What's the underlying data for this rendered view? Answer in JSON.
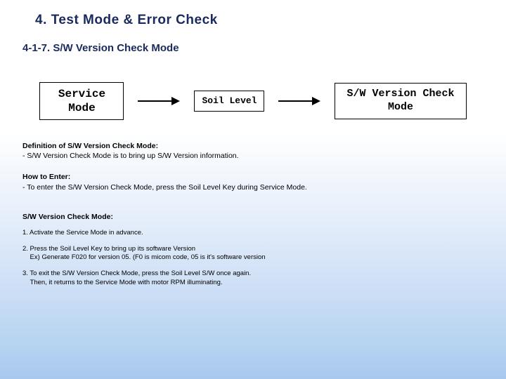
{
  "title": "4. Test Mode & Error Check",
  "subtitle": "4-1-7.  S/W Version Check Mode",
  "flow": {
    "box1_line1": "Service",
    "box1_line2": "Mode",
    "box2": "Soil Level",
    "box3_line1": "S/W Version Check",
    "box3_line2": "Mode"
  },
  "def": {
    "heading": "Definition of S/W Version Check Mode:",
    "line1": "- S/W Version Check Mode is to bring up S/W Version information."
  },
  "enter": {
    "heading": "How to Enter:",
    "line1": "- To enter the S/W Version Check Mode, press the Soil Level Key during Service Mode."
  },
  "mode_heading": "S/W Version Check Mode:",
  "steps": {
    "s1": "1. Activate the Service Mode in advance.",
    "s2a": "2. Press the Soil Level Key to bring up its software Version",
    "s2b": "    Ex) Generate F020 for version 05. (F0 is micom code, 05 is it's software version",
    "s3a": "3. To exit the S/W Version Check Mode, press the Soil Level S/W once again.",
    "s3b": "    Then, it returns to the Service Mode with motor RPM illuminating."
  }
}
